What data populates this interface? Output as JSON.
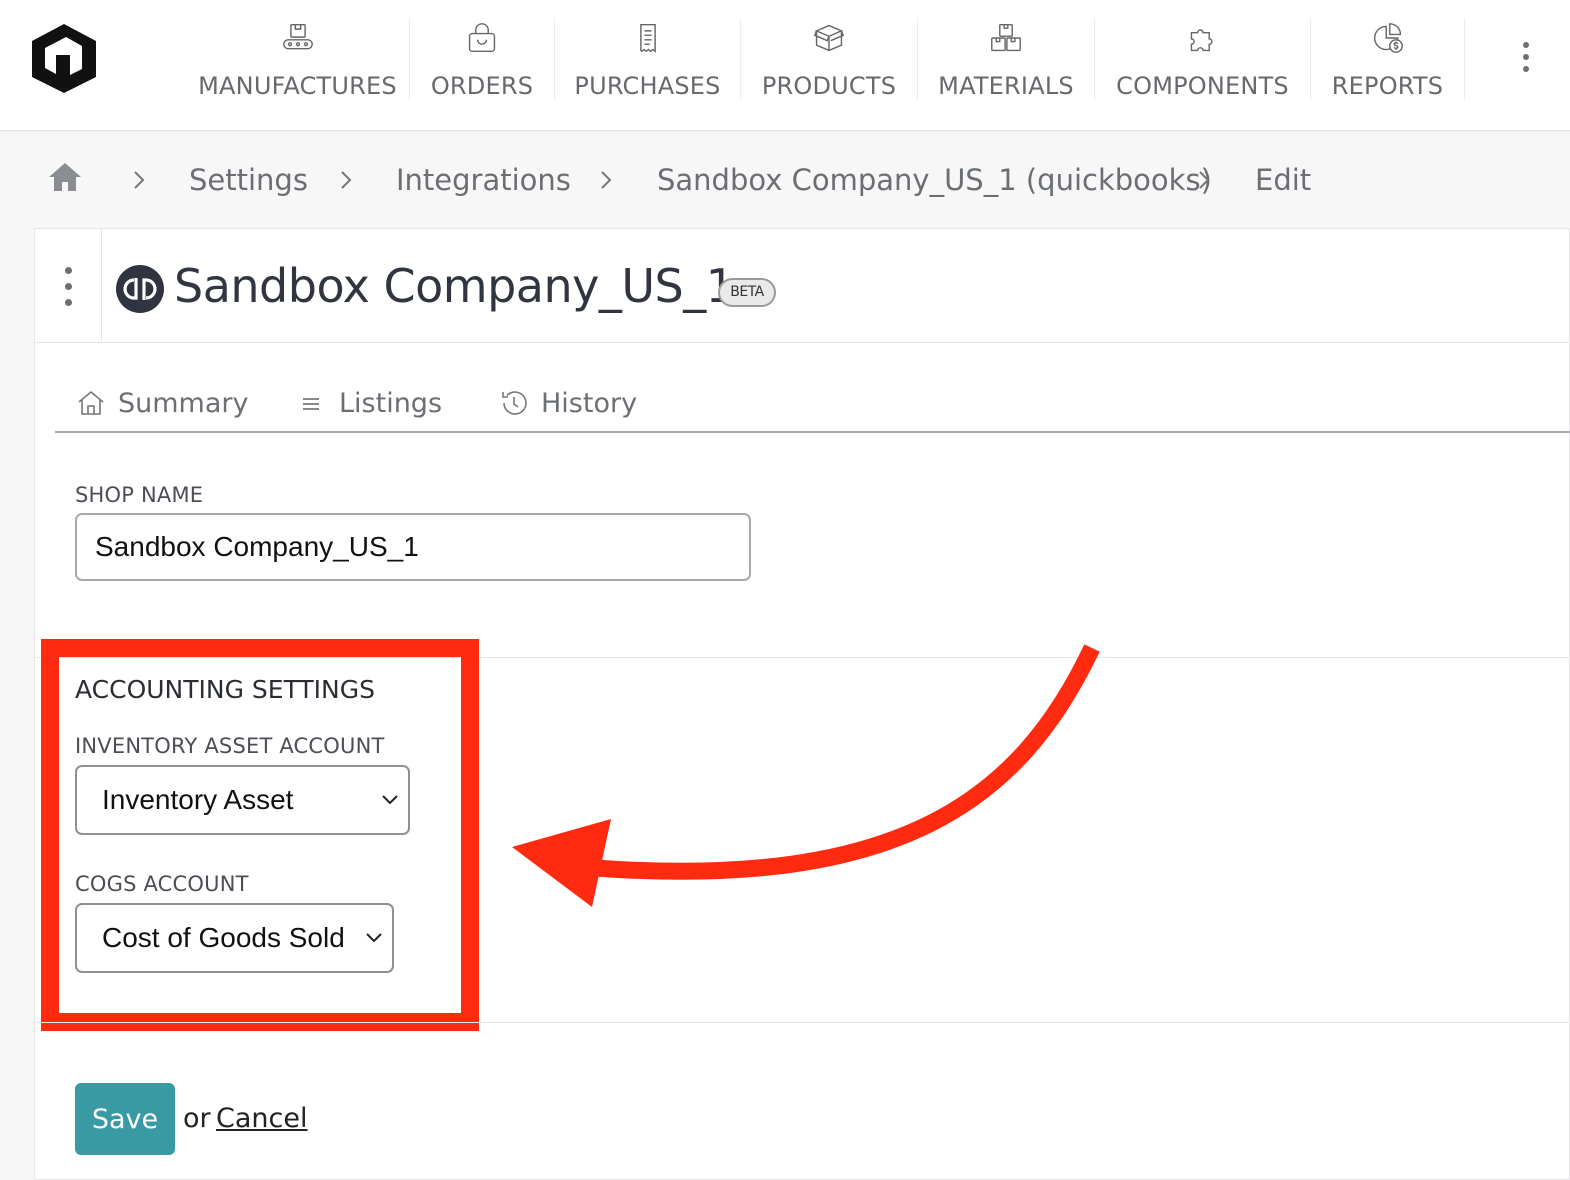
{
  "nav": {
    "items": [
      {
        "label": "MANUFACTURES",
        "icon": "conveyor-icon"
      },
      {
        "label": "ORDERS",
        "icon": "shopping-bag-icon"
      },
      {
        "label": "PURCHASES",
        "icon": "receipt-icon"
      },
      {
        "label": "PRODUCTS",
        "icon": "box-icon"
      },
      {
        "label": "MATERIALS",
        "icon": "boxes-icon"
      },
      {
        "label": "COMPONENTS",
        "icon": "puzzle-icon"
      },
      {
        "label": "REPORTS",
        "icon": "pie-dollar-icon"
      }
    ]
  },
  "breadcrumb": {
    "items": [
      "Settings",
      "Integrations",
      "Sandbox Company_US_1 (quickbooks)",
      "Edit"
    ]
  },
  "header": {
    "title": "Sandbox Company_US_1",
    "badge": "BETA"
  },
  "tabs": [
    {
      "label": "Summary",
      "icon": "home-outline-icon"
    },
    {
      "label": "Listings",
      "icon": "list-icon"
    },
    {
      "label": "History",
      "icon": "history-icon"
    }
  ],
  "form": {
    "shop_name_label": "SHOP NAME",
    "shop_name_value": "Sandbox Company_US_1",
    "accounting_title": "ACCOUNTING SETTINGS",
    "inventory_label": "INVENTORY ASSET ACCOUNT",
    "inventory_value": "Inventory Asset",
    "cogs_label": "COGS ACCOUNT",
    "cogs_value": "Cost of Goods Sold",
    "save_label": "Save",
    "or_text": "or",
    "cancel_label": "Cancel"
  },
  "colors": {
    "accent": "#3a9aa3",
    "highlight": "#ff2a0f",
    "title": "#30353f"
  }
}
